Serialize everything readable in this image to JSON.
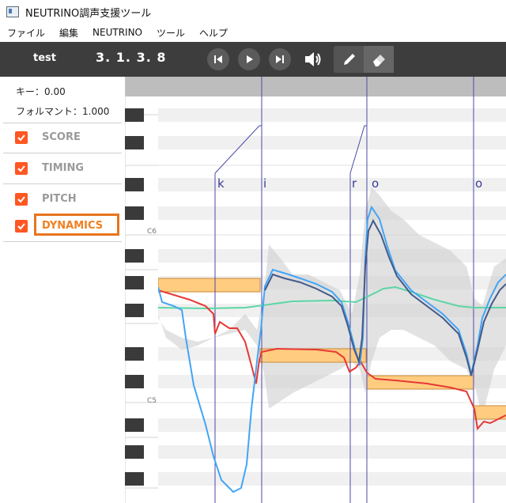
{
  "window": {
    "title": "NEUTRINO調声支援ツール"
  },
  "menu": {
    "items": [
      "ファイル",
      "編集",
      "NEUTRINO",
      "ツール",
      "ヘルプ"
    ]
  },
  "toolbar": {
    "song": "test",
    "position": "3. 1. 3. 8"
  },
  "params": {
    "key": "キー：0.00",
    "formant": "フォルマント：1.000"
  },
  "checks": [
    {
      "label": "SCORE",
      "checked": true
    },
    {
      "label": "TIMING",
      "checked": true
    },
    {
      "label": "PITCH",
      "checked": true
    },
    {
      "label": "DYNAMICS",
      "checked": true
    }
  ],
  "piano": {
    "labels": [
      "C6",
      "C5"
    ]
  },
  "lyrics": [
    "k",
    "i",
    "r",
    "o",
    "o"
  ],
  "colors": {
    "accent": "#ff5722",
    "highlight": "#e8741e",
    "note_fill": "#ffcc80",
    "pitch_score": "#e53935",
    "pitch_blue": "#42a5f5",
    "pitch_navy": "#455a8a",
    "dynamics": "#5cd6a6",
    "timing": "#4a4aa8"
  }
}
